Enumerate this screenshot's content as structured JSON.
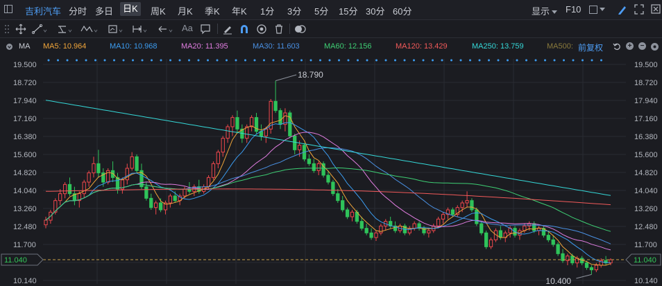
{
  "topbar": {
    "stock_name": "吉利汽车",
    "periods": [
      "分时",
      "多日",
      "日K",
      "周K",
      "月K",
      "季K",
      "年K",
      "1分",
      "3分",
      "5分",
      "15分",
      "30分",
      "60分"
    ],
    "active_period": "日K",
    "display_label": "显示",
    "f10_label": "F10"
  },
  "toolbar": {
    "text_tool_label": "Aa"
  },
  "legend": {
    "ma_label": "MA",
    "items": [
      {
        "text": "MA5: 10.964",
        "color": "#f0a53a"
      },
      {
        "text": "MA10: 10.968",
        "color": "#3c9cf0"
      },
      {
        "text": "MA20: 11.395",
        "color": "#e07de0"
      },
      {
        "text": "MA30: 11.603",
        "color": "#4a90e2"
      },
      {
        "text": "MA60: 12.156",
        "color": "#3ecf74"
      },
      {
        "text": "MA120: 13.429",
        "color": "#f25a5a"
      },
      {
        "text": "MA250: 13.759",
        "color": "#35d8d8"
      },
      {
        "text": "MA500:",
        "color": "#8a7a3c"
      }
    ],
    "adjust_label": "前复权"
  },
  "colors": {
    "up": "#f0484c",
    "down": "#2fc35a",
    "grid": "#2a2c33",
    "current_price_line": "#c8a048",
    "current_price_text": "#33c759"
  },
  "chart_data": {
    "type": "candlestick",
    "y_ticks": [
      "19.500",
      "18.720",
      "17.940",
      "17.160",
      "16.380",
      "15.600",
      "14.820",
      "14.040",
      "13.260",
      "12.480",
      "11.700",
      "10.920",
      "10.140"
    ],
    "ylim": [
      10.14,
      19.5
    ],
    "current_price": "11.040",
    "max_label": "18.790",
    "min_label": "10.400",
    "candles": [
      {
        "o": 12.55,
        "h": 12.9,
        "l": 12.4,
        "c": 12.75
      },
      {
        "o": 12.75,
        "h": 13.2,
        "l": 12.6,
        "c": 13.1
      },
      {
        "o": 13.1,
        "h": 13.7,
        "l": 13.0,
        "c": 13.6
      },
      {
        "o": 13.6,
        "h": 14.1,
        "l": 13.4,
        "c": 13.9
      },
      {
        "o": 13.9,
        "h": 14.4,
        "l": 13.7,
        "c": 14.3
      },
      {
        "o": 14.3,
        "h": 14.6,
        "l": 13.8,
        "c": 13.9
      },
      {
        "o": 13.9,
        "h": 14.2,
        "l": 13.4,
        "c": 13.6
      },
      {
        "o": 13.6,
        "h": 14.0,
        "l": 13.3,
        "c": 13.9
      },
      {
        "o": 13.9,
        "h": 14.5,
        "l": 13.7,
        "c": 14.4
      },
      {
        "o": 14.4,
        "h": 14.9,
        "l": 14.2,
        "c": 14.8
      },
      {
        "o": 14.8,
        "h": 15.5,
        "l": 14.6,
        "c": 15.2
      },
      {
        "o": 15.2,
        "h": 15.8,
        "l": 14.6,
        "c": 14.8
      },
      {
        "o": 14.8,
        "h": 15.0,
        "l": 14.2,
        "c": 14.4
      },
      {
        "o": 14.4,
        "h": 15.0,
        "l": 14.3,
        "c": 14.9
      },
      {
        "o": 14.9,
        "h": 15.3,
        "l": 14.4,
        "c": 14.6
      },
      {
        "o": 14.6,
        "h": 14.8,
        "l": 13.9,
        "c": 14.1
      },
      {
        "o": 14.1,
        "h": 14.6,
        "l": 13.9,
        "c": 14.5
      },
      {
        "o": 14.5,
        "h": 15.2,
        "l": 14.3,
        "c": 15.0
      },
      {
        "o": 15.0,
        "h": 15.7,
        "l": 14.9,
        "c": 15.5
      },
      {
        "o": 15.5,
        "h": 15.6,
        "l": 14.8,
        "c": 14.9
      },
      {
        "o": 14.9,
        "h": 15.2,
        "l": 14.1,
        "c": 14.2
      },
      {
        "o": 14.2,
        "h": 14.4,
        "l": 13.6,
        "c": 13.7
      },
      {
        "o": 13.7,
        "h": 13.9,
        "l": 13.2,
        "c": 13.3
      },
      {
        "o": 13.3,
        "h": 13.6,
        "l": 13.0,
        "c": 13.5
      },
      {
        "o": 13.5,
        "h": 13.7,
        "l": 13.1,
        "c": 13.2
      },
      {
        "o": 13.2,
        "h": 13.6,
        "l": 13.0,
        "c": 13.5
      },
      {
        "o": 13.5,
        "h": 13.9,
        "l": 13.3,
        "c": 13.8
      },
      {
        "o": 13.8,
        "h": 14.0,
        "l": 13.5,
        "c": 13.6
      },
      {
        "o": 13.6,
        "h": 13.9,
        "l": 13.4,
        "c": 13.8
      },
      {
        "o": 13.8,
        "h": 14.2,
        "l": 13.7,
        "c": 14.1
      },
      {
        "o": 14.1,
        "h": 14.4,
        "l": 13.9,
        "c": 14.0
      },
      {
        "o": 14.0,
        "h": 14.3,
        "l": 13.8,
        "c": 14.2
      },
      {
        "o": 14.2,
        "h": 14.5,
        "l": 13.9,
        "c": 14.0
      },
      {
        "o": 14.0,
        "h": 14.3,
        "l": 13.9,
        "c": 14.2
      },
      {
        "o": 14.2,
        "h": 14.7,
        "l": 14.1,
        "c": 14.6
      },
      {
        "o": 14.6,
        "h": 15.3,
        "l": 14.5,
        "c": 15.2
      },
      {
        "o": 15.2,
        "h": 15.8,
        "l": 15.0,
        "c": 15.7
      },
      {
        "o": 15.7,
        "h": 16.4,
        "l": 15.5,
        "c": 16.3
      },
      {
        "o": 16.3,
        "h": 16.9,
        "l": 16.1,
        "c": 16.8
      },
      {
        "o": 16.8,
        "h": 17.3,
        "l": 16.4,
        "c": 17.2
      },
      {
        "o": 17.2,
        "h": 17.5,
        "l": 16.5,
        "c": 16.7
      },
      {
        "o": 16.7,
        "h": 16.9,
        "l": 16.1,
        "c": 16.3
      },
      {
        "o": 16.3,
        "h": 16.9,
        "l": 16.1,
        "c": 16.8
      },
      {
        "o": 16.8,
        "h": 17.3,
        "l": 16.6,
        "c": 17.2
      },
      {
        "o": 17.2,
        "h": 17.4,
        "l": 16.5,
        "c": 16.6
      },
      {
        "o": 16.6,
        "h": 16.9,
        "l": 16.2,
        "c": 16.4
      },
      {
        "o": 16.4,
        "h": 16.8,
        "l": 16.1,
        "c": 16.7
      },
      {
        "o": 16.7,
        "h": 18.0,
        "l": 16.5,
        "c": 17.9
      },
      {
        "o": 17.9,
        "h": 18.79,
        "l": 17.4,
        "c": 17.5
      },
      {
        "o": 17.5,
        "h": 17.6,
        "l": 16.7,
        "c": 16.9
      },
      {
        "o": 16.9,
        "h": 17.6,
        "l": 16.6,
        "c": 17.4
      },
      {
        "o": 17.4,
        "h": 17.5,
        "l": 16.3,
        "c": 16.4
      },
      {
        "o": 16.4,
        "h": 16.5,
        "l": 15.6,
        "c": 15.8
      },
      {
        "o": 15.8,
        "h": 16.2,
        "l": 15.5,
        "c": 16.0
      },
      {
        "o": 16.0,
        "h": 16.1,
        "l": 15.3,
        "c": 15.4
      },
      {
        "o": 15.4,
        "h": 15.6,
        "l": 15.1,
        "c": 15.2
      },
      {
        "o": 15.2,
        "h": 15.4,
        "l": 14.8,
        "c": 14.9
      },
      {
        "o": 14.9,
        "h": 15.3,
        "l": 14.7,
        "c": 15.2
      },
      {
        "o": 15.2,
        "h": 15.3,
        "l": 14.6,
        "c": 14.7
      },
      {
        "o": 14.7,
        "h": 14.9,
        "l": 14.3,
        "c": 14.4
      },
      {
        "o": 14.4,
        "h": 14.5,
        "l": 13.8,
        "c": 13.9
      },
      {
        "o": 13.9,
        "h": 14.1,
        "l": 13.5,
        "c": 13.6
      },
      {
        "o": 13.6,
        "h": 13.8,
        "l": 13.1,
        "c": 13.2
      },
      {
        "o": 13.2,
        "h": 13.3,
        "l": 12.8,
        "c": 12.9
      },
      {
        "o": 12.9,
        "h": 13.2,
        "l": 12.7,
        "c": 13.1
      },
      {
        "o": 13.1,
        "h": 13.2,
        "l": 12.6,
        "c": 12.7
      },
      {
        "o": 12.7,
        "h": 12.9,
        "l": 12.3,
        "c": 12.4
      },
      {
        "o": 12.4,
        "h": 12.6,
        "l": 12.1,
        "c": 12.2
      },
      {
        "o": 12.2,
        "h": 12.4,
        "l": 11.9,
        "c": 12.0
      },
      {
        "o": 12.0,
        "h": 12.3,
        "l": 11.85,
        "c": 12.2
      },
      {
        "o": 12.2,
        "h": 12.6,
        "l": 12.1,
        "c": 12.5
      },
      {
        "o": 12.5,
        "h": 12.8,
        "l": 12.3,
        "c": 12.7
      },
      {
        "o": 12.7,
        "h": 12.9,
        "l": 12.4,
        "c": 12.5
      },
      {
        "o": 12.5,
        "h": 12.7,
        "l": 12.2,
        "c": 12.3
      },
      {
        "o": 12.3,
        "h": 12.6,
        "l": 12.2,
        "c": 12.5
      },
      {
        "o": 12.5,
        "h": 12.6,
        "l": 12.1,
        "c": 12.2
      },
      {
        "o": 12.2,
        "h": 12.5,
        "l": 12.1,
        "c": 12.4
      },
      {
        "o": 12.4,
        "h": 12.7,
        "l": 12.3,
        "c": 12.6
      },
      {
        "o": 12.6,
        "h": 12.7,
        "l": 12.3,
        "c": 12.4
      },
      {
        "o": 12.4,
        "h": 12.5,
        "l": 12.1,
        "c": 12.2
      },
      {
        "o": 12.2,
        "h": 12.4,
        "l": 12.0,
        "c": 12.3
      },
      {
        "o": 12.3,
        "h": 12.6,
        "l": 12.2,
        "c": 12.5
      },
      {
        "o": 12.5,
        "h": 12.9,
        "l": 12.4,
        "c": 12.8
      },
      {
        "o": 12.8,
        "h": 13.1,
        "l": 12.6,
        "c": 13.0
      },
      {
        "o": 13.0,
        "h": 13.3,
        "l": 12.8,
        "c": 13.2
      },
      {
        "o": 13.2,
        "h": 13.3,
        "l": 12.9,
        "c": 13.0
      },
      {
        "o": 13.0,
        "h": 13.4,
        "l": 12.9,
        "c": 13.3
      },
      {
        "o": 13.3,
        "h": 13.6,
        "l": 13.1,
        "c": 13.5
      },
      {
        "o": 13.5,
        "h": 14.0,
        "l": 13.3,
        "c": 13.6
      },
      {
        "o": 13.6,
        "h": 13.7,
        "l": 13.1,
        "c": 13.2
      },
      {
        "o": 13.2,
        "h": 13.3,
        "l": 12.5,
        "c": 12.6
      },
      {
        "o": 12.6,
        "h": 12.7,
        "l": 12.1,
        "c": 12.2
      },
      {
        "o": 12.2,
        "h": 12.3,
        "l": 11.5,
        "c": 11.6
      },
      {
        "o": 11.6,
        "h": 12.0,
        "l": 11.5,
        "c": 11.9
      },
      {
        "o": 11.9,
        "h": 12.4,
        "l": 11.8,
        "c": 12.3
      },
      {
        "o": 12.3,
        "h": 12.5,
        "l": 11.9,
        "c": 12.0
      },
      {
        "o": 12.0,
        "h": 12.3,
        "l": 11.8,
        "c": 12.2
      },
      {
        "o": 12.2,
        "h": 12.5,
        "l": 12.0,
        "c": 12.4
      },
      {
        "o": 12.4,
        "h": 12.5,
        "l": 12.0,
        "c": 12.1
      },
      {
        "o": 12.1,
        "h": 12.4,
        "l": 11.9,
        "c": 12.3
      },
      {
        "o": 12.3,
        "h": 12.6,
        "l": 12.2,
        "c": 12.5
      },
      {
        "o": 12.5,
        "h": 12.7,
        "l": 12.3,
        "c": 12.6
      },
      {
        "o": 12.6,
        "h": 12.7,
        "l": 12.2,
        "c": 12.3
      },
      {
        "o": 12.3,
        "h": 12.5,
        "l": 12.1,
        "c": 12.4
      },
      {
        "o": 12.4,
        "h": 12.5,
        "l": 12.0,
        "c": 12.1
      },
      {
        "o": 12.1,
        "h": 12.3,
        "l": 11.8,
        "c": 11.9
      },
      {
        "o": 11.9,
        "h": 12.1,
        "l": 11.6,
        "c": 11.7
      },
      {
        "o": 11.7,
        "h": 11.8,
        "l": 11.2,
        "c": 11.3
      },
      {
        "o": 11.3,
        "h": 11.5,
        "l": 10.9,
        "c": 11.0
      },
      {
        "o": 11.0,
        "h": 11.3,
        "l": 10.8,
        "c": 11.2
      },
      {
        "o": 11.2,
        "h": 11.3,
        "l": 10.8,
        "c": 10.9
      },
      {
        "o": 10.9,
        "h": 11.2,
        "l": 10.7,
        "c": 11.1
      },
      {
        "o": 11.1,
        "h": 11.2,
        "l": 10.8,
        "c": 10.9
      },
      {
        "o": 10.9,
        "h": 11.0,
        "l": 10.6,
        "c": 10.7
      },
      {
        "o": 10.7,
        "h": 10.8,
        "l": 10.4,
        "c": 10.6
      },
      {
        "o": 10.6,
        "h": 10.9,
        "l": 10.5,
        "c": 10.8
      },
      {
        "o": 10.8,
        "h": 11.1,
        "l": 10.7,
        "c": 11.0
      },
      {
        "o": 11.0,
        "h": 11.2,
        "l": 10.8,
        "c": 10.9
      },
      {
        "o": 10.9,
        "h": 11.1,
        "l": 10.8,
        "c": 11.04
      }
    ]
  }
}
